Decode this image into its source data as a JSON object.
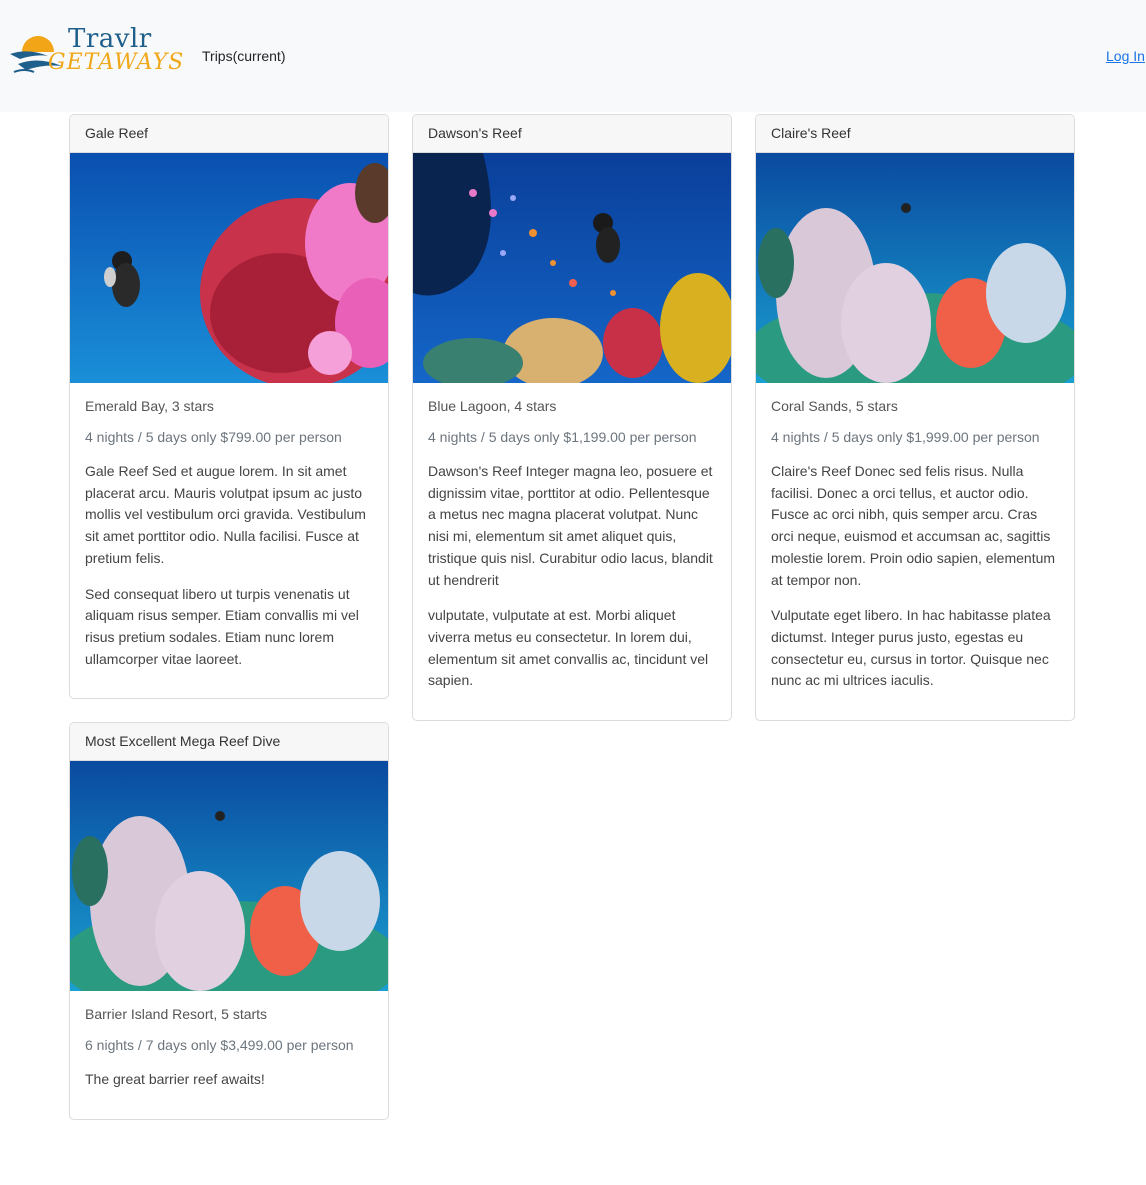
{
  "brand": {
    "line1": "Travlr",
    "line2": "GETAWAYS"
  },
  "nav": {
    "trips_label": "Trips(current)",
    "login_label": "Log In"
  },
  "trips": [
    {
      "name": "Gale Reef",
      "resort": "Emerald Bay, 3 stars",
      "price_line": "4 nights / 5 days only $799.00 per person",
      "desc": [
        "Gale Reef Sed et augue lorem. In sit amet placerat arcu. Mauris volutpat ipsum ac justo mollis vel vestibulum orci gravida. Vestibulum sit amet porttitor odio. Nulla facilisi. Fusce at pretium felis.",
        "Sed consequat libero ut turpis venenatis ut aliquam risus semper. Etiam convallis mi vel risus pretium sodales. Etiam nunc lorem ullamcorper vitae laoreet."
      ]
    },
    {
      "name": "Dawson's Reef",
      "resort": "Blue Lagoon, 4 stars",
      "price_line": "4 nights / 5 days only $1,199.00 per person",
      "desc": [
        "Dawson's Reef Integer magna leo, posuere et dignissim vitae, porttitor at odio. Pellentesque a metus nec magna placerat volutpat. Nunc nisi mi, elementum sit amet aliquet quis, tristique quis nisl. Curabitur odio lacus, blandit ut hendrerit",
        "vulputate, vulputate at est. Morbi aliquet viverra metus eu consectetur. In lorem dui, elementum sit amet convallis ac, tincidunt vel sapien."
      ]
    },
    {
      "name": "Claire's Reef",
      "resort": "Coral Sands, 5 stars",
      "price_line": "4 nights / 5 days only $1,999.00 per person",
      "desc": [
        "Claire's Reef Donec sed felis risus. Nulla facilisi. Donec a orci tellus, et auctor odio. Fusce ac orci nibh, quis semper arcu. Cras orci neque, euismod et accumsan ac, sagittis molestie lorem. Proin odio sapien, elementum at tempor non.",
        "Vulputate eget libero. In hac habitasse platea dictumst. Integer purus justo, egestas eu consectetur eu, cursus in tortor. Quisque nec nunc ac mi ultrices iaculis."
      ]
    },
    {
      "name": "Most Excellent Mega Reef Dive",
      "resort": "Barrier Island Resort, 5 starts",
      "price_line": "6 nights / 7 days only $3,499.00 per person",
      "desc": [
        "The great barrier reef awaits!"
      ]
    }
  ]
}
